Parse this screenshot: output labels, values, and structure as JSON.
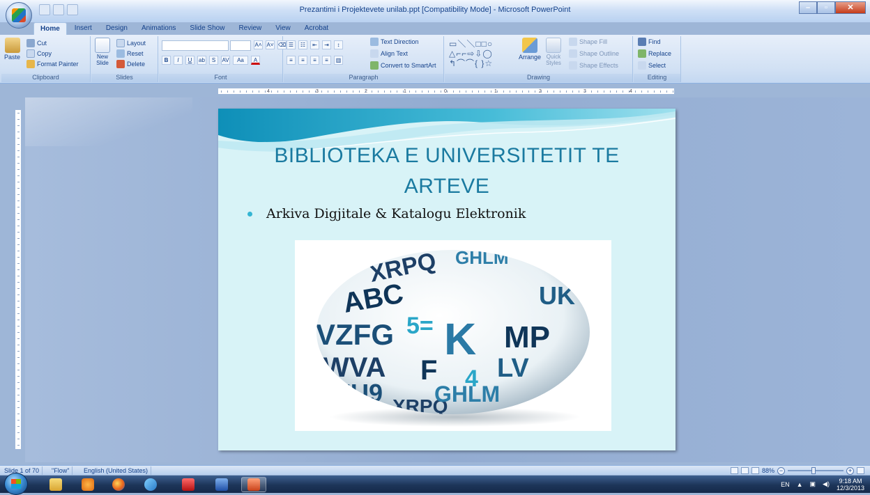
{
  "window": {
    "title": "Prezantimi i Projektevete unilab.ppt [Compatibility Mode] - Microsoft PowerPoint"
  },
  "ribbon_tabs": [
    "Home",
    "Insert",
    "Design",
    "Animations",
    "Slide Show",
    "Review",
    "View",
    "Acrobat"
  ],
  "active_tab": "Home",
  "clipboard": {
    "paste": "Paste",
    "cut": "Cut",
    "copy": "Copy",
    "format_painter": "Format Painter",
    "label": "Clipboard"
  },
  "slides_group": {
    "new_slide": "New Slide",
    "layout": "Layout",
    "reset": "Reset",
    "delete": "Delete",
    "label": "Slides"
  },
  "font_group": {
    "grow": "A˄",
    "shrink": "A˅",
    "clear": "Aa",
    "label": "Font"
  },
  "paragraph_group": {
    "text_direction": "Text Direction",
    "align_text": "Align Text",
    "convert_smartart": "Convert to SmartArt",
    "label": "Paragraph"
  },
  "drawing_group": {
    "arrange": "Arrange",
    "quick_styles": "Quick Styles",
    "shape_fill": "Shape Fill",
    "shape_outline": "Shape Outline",
    "shape_effects": "Shape Effects",
    "label": "Drawing"
  },
  "editing_group": {
    "find": "Find",
    "replace": "Replace",
    "select": "Select",
    "label": "Editing"
  },
  "ruler": {
    "numbers": [
      "4",
      "3",
      "2",
      "1",
      "0",
      "1",
      "2",
      "3",
      "4"
    ]
  },
  "slide": {
    "title_line1": "BIBLIOTEKA E UNIVERSITETIT TE",
    "title_line2": "ARTEVE",
    "bullet": "Arkiva Digjitale & Katalogu  Elektronik",
    "image_letters": [
      "ABC",
      "K",
      "5=",
      "VZFG",
      "WVA",
      "MP",
      "LV",
      "ZU9",
      "F",
      "4",
      "GHLM",
      "XRPQ",
      "UK"
    ]
  },
  "status": {
    "slide_info": "Slide 1 of 70",
    "theme": "\"Flow\"",
    "language": "English (United States)",
    "zoom": "88%"
  },
  "taskbar": {
    "apps": [
      "explorer-icon",
      "media-player-icon",
      "firefox-icon",
      "network-icon",
      "acrobat-icon",
      "word-icon",
      "powerpoint-icon"
    ],
    "tray_lang": "EN",
    "time": "9:18 AM",
    "date": "12/3/2013"
  },
  "colors": {
    "accent": "#1a7aa0",
    "slide_bg": "#d8f3f7",
    "bullet": "#35b5d3"
  }
}
